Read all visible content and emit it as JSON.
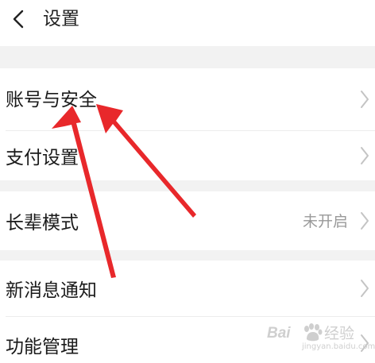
{
  "header": {
    "title": "设置"
  },
  "settings": {
    "account_security": "账号与安全",
    "payment_settings": "支付设置",
    "elder_mode": "长辈模式",
    "elder_mode_value": "未开启",
    "new_message_notify": "新消息通知",
    "feature_management": "功能管理"
  },
  "watermark": {
    "brand_left": "Bai",
    "brand_right": "经验",
    "url": "jingyan.baidu.com"
  },
  "colors": {
    "annotation_arrow": "#e8282b",
    "section_gap": "#f2f2f2",
    "chevron": "#c4c4c4"
  },
  "icons": {
    "back": "chevron-left-icon",
    "row_arrow": "chevron-right-icon",
    "watermark_logo": "baidu-paw-icon"
  }
}
